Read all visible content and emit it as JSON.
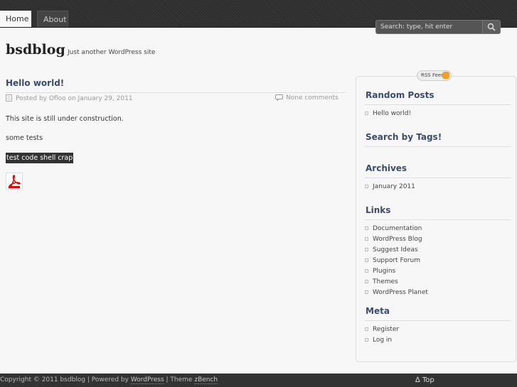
{
  "nav": {
    "tabs": [
      {
        "label": "Home"
      },
      {
        "label": "About"
      }
    ],
    "search_placeholder": "Search: type, hit enter"
  },
  "header": {
    "site_title": "bsdblog",
    "tagline": "Just another WordPress site"
  },
  "post": {
    "title": "Hello world!",
    "meta": "Posted by Ofloo on January 29, 2011",
    "comments": "None comments",
    "paragraphs": [
      "This site is still under construction.",
      "some tests"
    ],
    "code": "test code shell crap"
  },
  "sidebar": {
    "rss_label": "RSS Feed",
    "widgets": [
      {
        "title": "Random Posts",
        "items": [
          "Hello world!"
        ]
      },
      {
        "title": "Search by Tags!",
        "items": []
      },
      {
        "title": "Archives",
        "items": [
          "January 2011"
        ]
      },
      {
        "title": "Links",
        "items": [
          "Documentation",
          "WordPress Blog",
          "Suggest Ideas",
          "Support Forum",
          "Plugins",
          "Themes",
          "WordPress Planet"
        ]
      },
      {
        "title": "Meta",
        "items": [
          "Register",
          "Log in"
        ]
      }
    ]
  },
  "footer": {
    "copyright": "Copyright © 2011 bsdblog",
    "powered_prefix": "| Powered by",
    "powered_link": "WordPress",
    "theme_prefix": "| Theme",
    "theme_link": "zBench",
    "top_link": "∆ Top"
  },
  "colors": {
    "topbar": "#2e2e2e",
    "accent_title": "#3b4b6b",
    "background": "#f7f7f7"
  }
}
